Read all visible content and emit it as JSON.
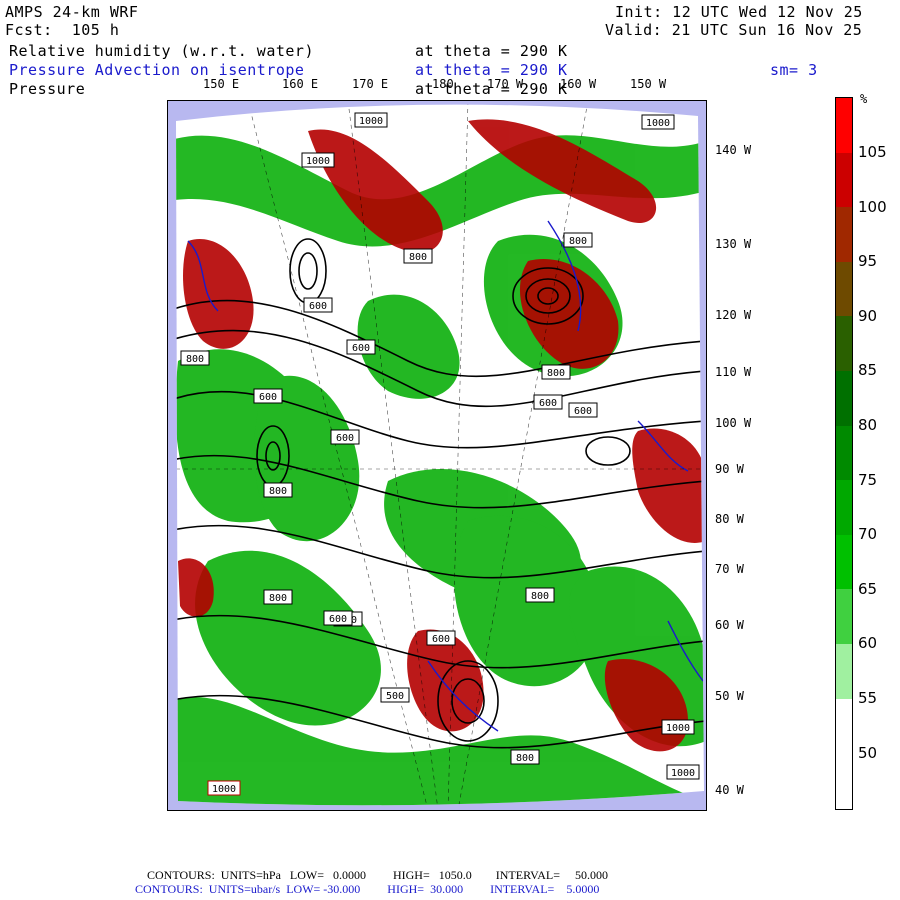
{
  "header": {
    "model": "AMPS 24-km WRF",
    "forecast": "Fcst:  105 h",
    "init": "Init: 12 UTC Wed 12 Nov 25",
    "valid": "Valid: 21 UTC Sun 16 Nov 25",
    "fields": [
      {
        "name": "Relative humidity (w.r.t. water)",
        "level": "at theta = 290 K",
        "color": "#000000"
      },
      {
        "name": "Pressure Advection on isentrope",
        "level": "at theta = 290 K",
        "color": "#1a1acc"
      },
      {
        "name": "Pressure",
        "level": "at theta = 290 K",
        "color": "#000000"
      }
    ],
    "smoothing": "sm= 3"
  },
  "map": {
    "lon_labels": [
      "150 E",
      "160 E",
      "170 E",
      "180",
      "170 W",
      "160 W",
      "150 W"
    ],
    "lat_labels": [
      "140 W",
      "130 W",
      "120 W",
      "110 W",
      "100 W",
      "90 W",
      "80 W",
      "70 W",
      "60 W",
      "50 W",
      "40 W"
    ],
    "pressure_labels": [
      "1000",
      "1000",
      "1000",
      "800",
      "800",
      "800",
      "600",
      "600",
      "600",
      "600",
      "800",
      "800",
      "600",
      "600",
      "800",
      "600",
      "800",
      "600",
      "800",
      "1000",
      "1000",
      "1000",
      "500",
      "600"
    ],
    "colors": {
      "ocean_ice": "#b8b8f0",
      "humid_green": "#18b418",
      "humid_red": "#b40000",
      "contour": "#000000",
      "advection": "#1a1acc"
    }
  },
  "colorbar": {
    "unit": "%",
    "ticks": [
      "105",
      "100",
      "95",
      "90",
      "85",
      "80",
      "75",
      "70",
      "65",
      "60",
      "55",
      "50"
    ],
    "segments": [
      "#ff0000",
      "#cc0000",
      "#a02800",
      "#6e4a00",
      "#2a6000",
      "#007000",
      "#008a00",
      "#00a800",
      "#00c000",
      "#40d040",
      "#a0f0a0",
      "#ffffff",
      "#ffffff"
    ]
  },
  "footer": {
    "line1": "CONTOURS:  UNITS=hPa   LOW=   0.0000         HIGH=   1050.0        INTERVAL=     50.000",
    "line2": "CONTOURS:  UNITS=ubar/s  LOW= -30.000         HIGH=  30.000         INTERVAL=    5.0000"
  }
}
